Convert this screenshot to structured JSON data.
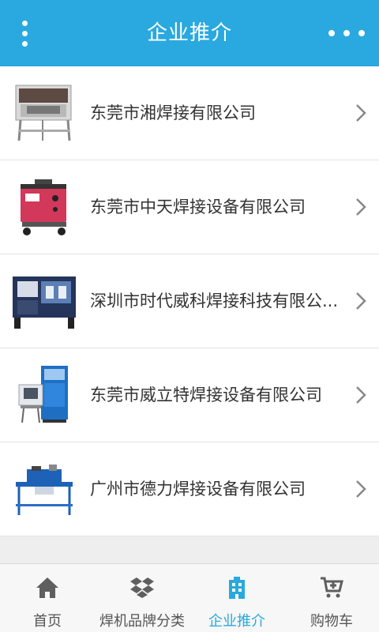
{
  "header": {
    "title": "企业推介",
    "menu_icon": "vertical-dots-icon",
    "more_icon": "horizontal-dots-icon"
  },
  "companies": [
    {
      "name": "东莞市湘焊接有限公司",
      "image": "welding-machine-photo"
    },
    {
      "name": "东莞市中天焊接设备有限公司",
      "image": "welding-machine-photo"
    },
    {
      "name": "深圳市时代威科焊接科技有限公...",
      "image": "welding-machine-photo"
    },
    {
      "name": "东莞市威立特焊接设备有限公司",
      "image": "welding-machine-photo"
    },
    {
      "name": "广州市德力焊接设备有限公司",
      "image": "welding-machine-photo"
    }
  ],
  "tabs": [
    {
      "label": "首页",
      "icon": "home-icon",
      "active": false
    },
    {
      "label": "焊机品牌分类",
      "icon": "dropbox-icon",
      "active": false
    },
    {
      "label": "企业推介",
      "icon": "building-icon",
      "active": true
    },
    {
      "label": "购物车",
      "icon": "cart-icon",
      "active": false
    }
  ],
  "colors": {
    "primary": "#29a9df",
    "text": "#333333",
    "tab_text": "#555555"
  }
}
